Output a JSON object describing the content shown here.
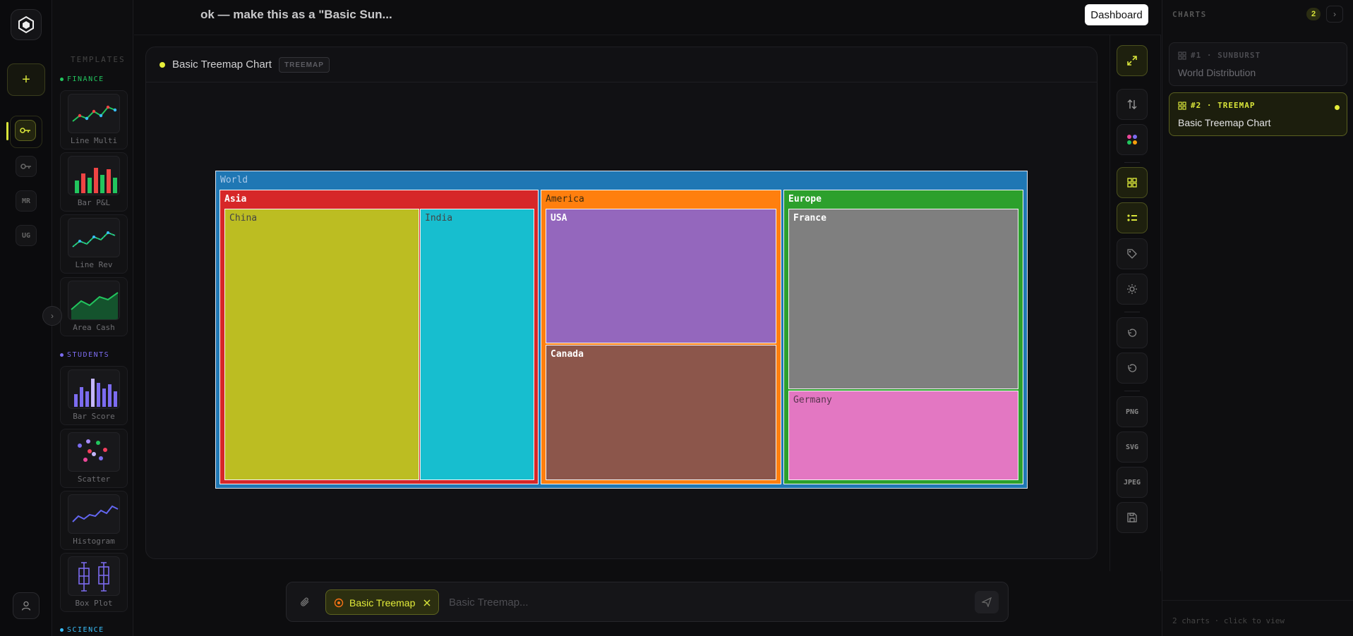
{
  "topbar": {
    "conversation_title": "ok — make this as a \"Basic Sun...",
    "dashboard_label": "Dashboard"
  },
  "rail": {
    "new_label": "+",
    "chips": [
      "MR",
      "UG"
    ]
  },
  "templates": {
    "heading": "TEMPLATES",
    "sections": [
      {
        "label": "FINANCE",
        "color": "#22c55e",
        "items": [
          "Line Multi",
          "Bar P&L",
          "Line Rev",
          "Area Cash"
        ]
      },
      {
        "label": "STUDENTS",
        "color": "#7c6cf0",
        "items": [
          "Bar Score",
          "Scatter",
          "Histogram",
          "Box Plot"
        ]
      },
      {
        "label": "SCIENCE",
        "color": "#38bdf8",
        "items": []
      }
    ]
  },
  "chart": {
    "title": "Basic Treemap Chart",
    "badge": "TREEMAP"
  },
  "chart_data": {
    "type": "treemap",
    "root": "World",
    "groups": [
      {
        "name": "Asia",
        "color": "#d62728",
        "children": [
          {
            "name": "China",
            "color": "#bcbd22"
          },
          {
            "name": "India",
            "color": "#17becf"
          }
        ]
      },
      {
        "name": "America",
        "color": "#ff7f0e",
        "children": [
          {
            "name": "USA",
            "color": "#9467bd"
          },
          {
            "name": "Canada",
            "color": "#8c564b"
          }
        ]
      },
      {
        "name": "Europe",
        "color": "#2ca02c",
        "children": [
          {
            "name": "France",
            "color": "#7f7f7f"
          },
          {
            "name": "Germany",
            "color": "#e377c2"
          }
        ]
      }
    ],
    "root_color": "#1f77b4"
  },
  "toolbar": {
    "export_labels": [
      "PNG",
      "SVG",
      "JPEG"
    ]
  },
  "charts_panel": {
    "heading": "CHARTS",
    "count": "2",
    "items": [
      {
        "meta": "#1 · SUNBURST",
        "name": "World Distribution"
      },
      {
        "meta": "#2 · TREEMAP",
        "name": "Basic Treemap Chart"
      }
    ],
    "footer": "2 charts · click to view"
  },
  "composer": {
    "pill_label": "Basic Treemap",
    "placeholder": "Basic Treemap..."
  },
  "colors": {
    "accent": "#d8e43a"
  }
}
